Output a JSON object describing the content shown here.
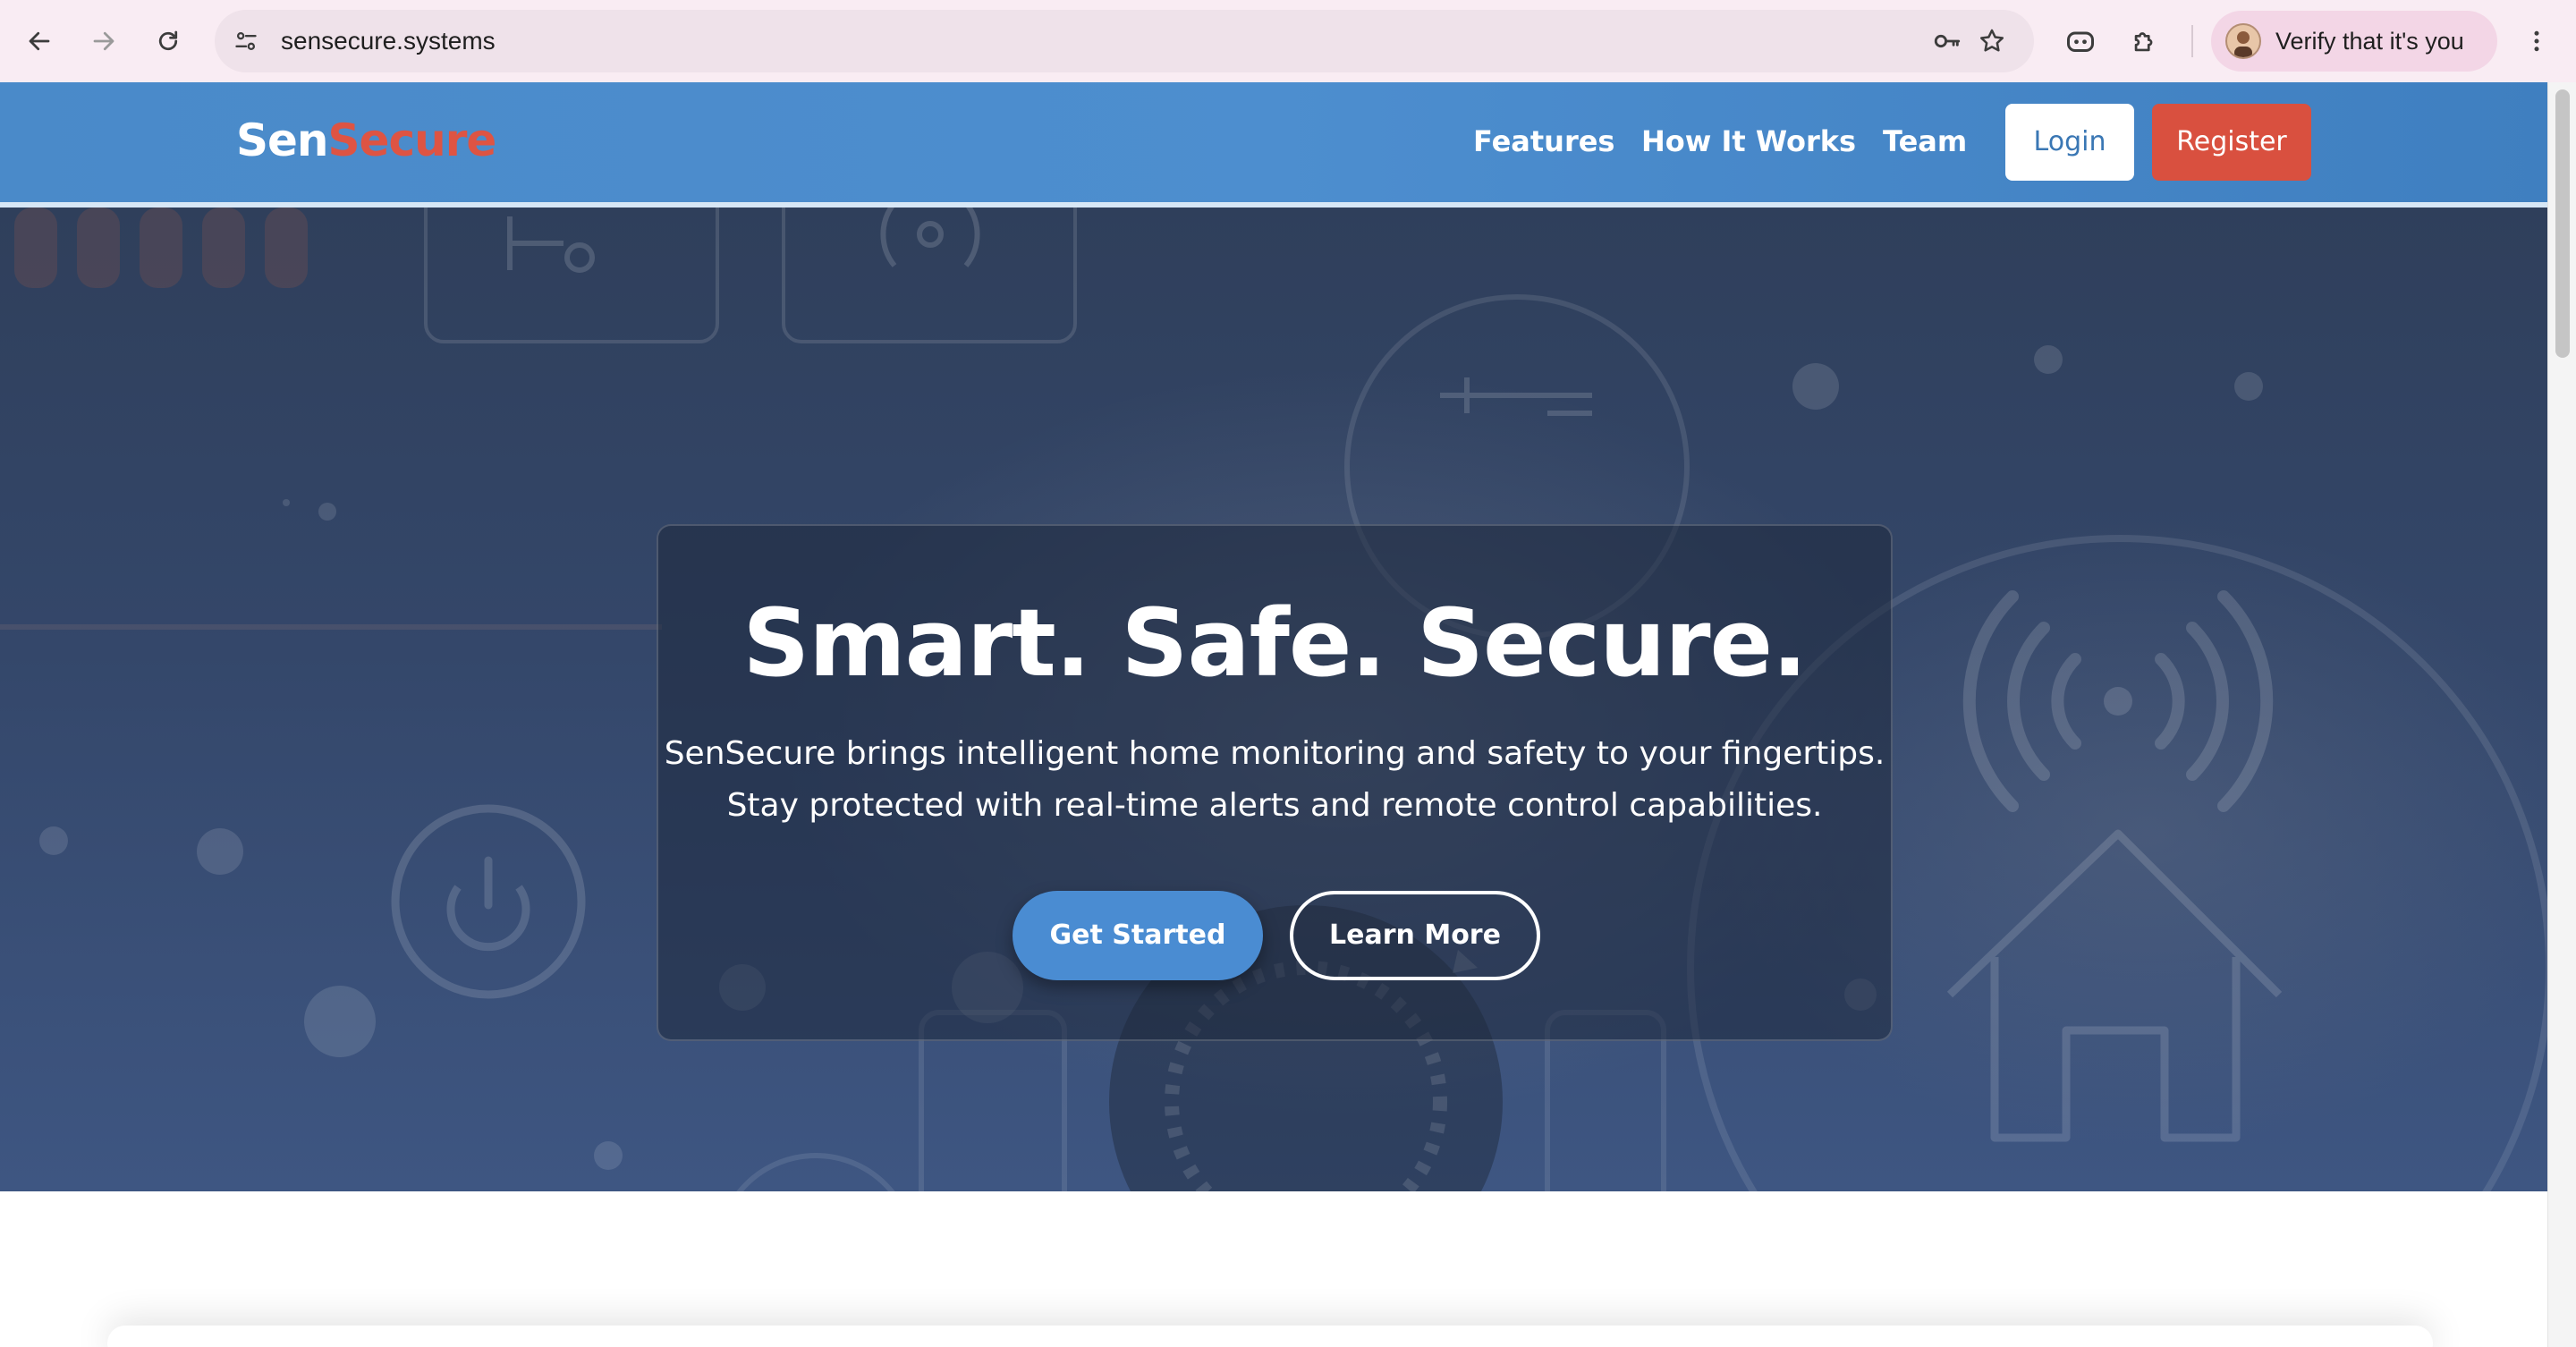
{
  "browser": {
    "url": "sensecure.systems",
    "profile_label": "Verify that it's you",
    "icons": {
      "back": "arrow-left-icon",
      "forward": "arrow-right-icon",
      "reload": "reload-icon",
      "site_info": "tune-icon",
      "password": "key-icon",
      "bookmark": "star-icon",
      "incognito": "incognito-icon",
      "extensions": "puzzle-icon",
      "menu": "kebab-menu-icon"
    }
  },
  "header": {
    "logo_part1": "Sen",
    "logo_part2": "Secure",
    "nav": [
      "Features",
      "How It Works",
      "Team"
    ],
    "login_label": "Login",
    "register_label": "Register",
    "colors": {
      "bar": "#4a8ac9",
      "register": "#d9503f",
      "logo_accent": "#de5443"
    }
  },
  "hero": {
    "title": "Smart. Safe. Secure.",
    "subtitle_line1": "SenSecure brings intelligent home monitoring and safety to your fingertips.",
    "subtitle_line2": "Stay protected with real-time alerts and remote control capabilities.",
    "primary_cta": "Get Started",
    "secondary_cta": "Learn More",
    "colors": {
      "primary_cta": "#4a8cd2"
    }
  }
}
